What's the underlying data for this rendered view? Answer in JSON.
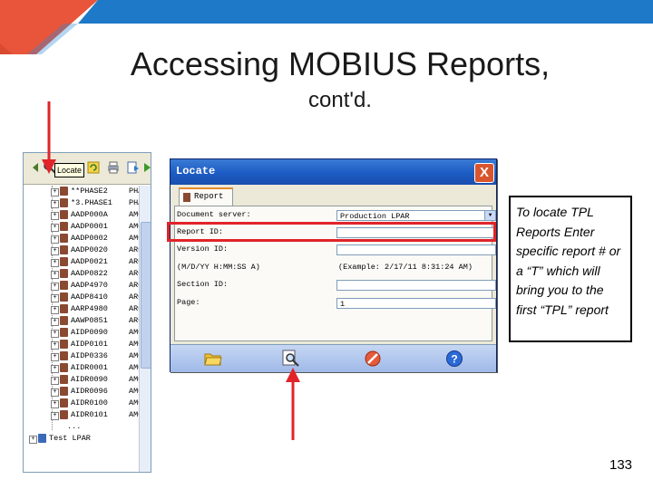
{
  "slide": {
    "title": "Accessing MOBIUS Reports,",
    "subtitle": "cont'd.",
    "page_number": "133",
    "accent_colors": {
      "blue": "#1e7ac8",
      "orange": "#e8553a",
      "arrow_red": "#e0242a"
    }
  },
  "toolbar": {
    "tooltip": "Locate"
  },
  "tree": {
    "rows": [
      {
        "name": "**PHASE2",
        "col2": "PHA"
      },
      {
        "name": "*3.PHASE1",
        "col2": "PHA"
      },
      {
        "name": "AADP000A",
        "col2": "AMC"
      },
      {
        "name": "AADP0001",
        "col2": "AMC"
      },
      {
        "name": "AADP0002",
        "col2": "AMC"
      },
      {
        "name": "AADP0020",
        "col2": "ARC"
      },
      {
        "name": "AADP0021",
        "col2": "ARC"
      },
      {
        "name": "AADP0822",
        "col2": "ARC"
      },
      {
        "name": "AADP4970",
        "col2": "ARC"
      },
      {
        "name": "AADP8410",
        "col2": "ARC"
      },
      {
        "name": "AARP4980",
        "col2": "ARC"
      },
      {
        "name": "AAWP0851",
        "col2": "ARC"
      },
      {
        "name": "AIDP0090",
        "col2": "AMC"
      },
      {
        "name": "AIDP0101",
        "col2": "AMC"
      },
      {
        "name": "AIDP0336",
        "col2": "AMC"
      },
      {
        "name": "AIDR0001",
        "col2": "AMC"
      },
      {
        "name": "AIDR0090",
        "col2": "AMC"
      },
      {
        "name": "AIDR0096",
        "col2": "AMC"
      },
      {
        "name": "AIDR0100",
        "col2": "AMC"
      },
      {
        "name": "AIDR0101",
        "col2": "AMC"
      }
    ],
    "more": "...",
    "bottom_item": "Test LPAR"
  },
  "dialog": {
    "title": "Locate",
    "close": "X",
    "tab_label": "Report",
    "fields": {
      "document_server_label": "Document server:",
      "document_server_value": "Production LPAR",
      "report_id_label": "Report ID:",
      "report_id_value": "",
      "version_id_label": "Version ID:",
      "version_id_value": "",
      "datetime_format": "(M/D/YY H:MM:SS A)",
      "datetime_example": "(Example: 2/17/11 8:31:24 AM)",
      "section_id_label": "Section ID:",
      "section_id_value": "",
      "page_label": "Page:",
      "page_value": "1"
    },
    "footer_icons": [
      "open-folder-icon",
      "search-icon",
      "cancel-icon",
      "help-icon"
    ]
  },
  "callout": {
    "text": "To locate TPL Reports Enter specific report # or a “T” which will bring you to the first “TPL” report"
  }
}
